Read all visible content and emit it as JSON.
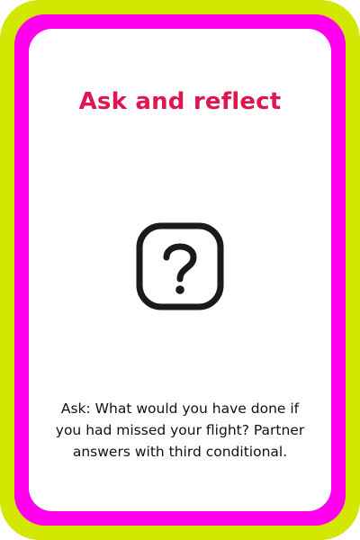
{
  "card": {
    "title": "Ask and reflect",
    "body": "Ask: What would you have done if you had missed your flight? Partner answers with third conditional.",
    "icon": "question-mark-icon"
  },
  "colors": {
    "outer_border": "#d3e600",
    "inner_border": "#ff00ee",
    "title": "#e0174f",
    "body_text": "#111111",
    "icon": "#1a1a1a",
    "card_background": "#ffffff"
  }
}
